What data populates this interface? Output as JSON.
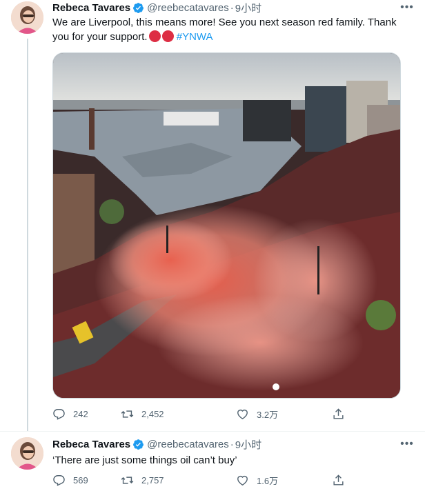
{
  "tweets": [
    {
      "author": {
        "name": "Rebeca Tavares",
        "handle": "@reebecatavares",
        "separator": "·",
        "time": "9小时"
      },
      "text": "We are Liverpool, this means more! See you next season red family. Thank you for your support.",
      "emoji": "red-circle-emoji ×2",
      "hashtag": "#YNWA",
      "media": {
        "description_icon": "liverpool-parade-photo"
      },
      "stats": {
        "replies": "242",
        "retweets": "2,452",
        "likes": "3.2万"
      },
      "more_icon": "•••"
    },
    {
      "author": {
        "name": "Rebeca Tavares",
        "handle": "@reebecatavares",
        "separator": "·",
        "time": "9小时"
      },
      "text": "‘There are just some things oil can’t buy’",
      "stats": {
        "replies": "569",
        "retweets": "2,757",
        "likes": "1.6万"
      },
      "more_icon": "•••"
    }
  ],
  "colors": {
    "accent": "#1d9bf0",
    "muted": "#536471",
    "text": "#0f1419",
    "red": "#dd2e44"
  }
}
